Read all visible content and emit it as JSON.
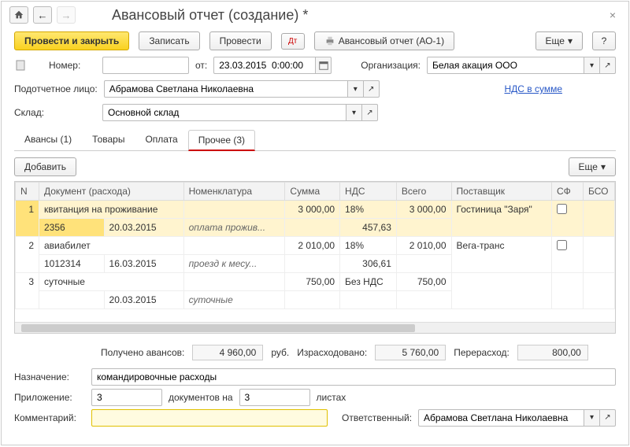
{
  "header": {
    "title": "Авансовый отчет (создание) *"
  },
  "toolbar": {
    "post_close": "Провести и закрыть",
    "save": "Записать",
    "post": "Провести",
    "print": "Авансовый отчет (АО-1)",
    "more": "Еще"
  },
  "form": {
    "number_label": "Номер:",
    "number": "",
    "from_label": "от:",
    "date": "23.03.2015  0:00:00",
    "org_label": "Организация:",
    "org": "Белая акация ООО",
    "person_label": "Подотчетное лицо:",
    "person": "Абрамова Светлана Николаевна",
    "vat_link": "НДС в сумме",
    "warehouse_label": "Склад:",
    "warehouse": "Основной склад"
  },
  "tabs": {
    "t0": "Авансы (1)",
    "t1": "Товары",
    "t2": "Оплата",
    "t3": "Прочее (3)"
  },
  "subtoolbar": {
    "add": "Добавить",
    "more": "Еще"
  },
  "cols": {
    "n": "N",
    "doc": "Документ (расхода)",
    "nomen": "Номенклатура",
    "sum": "Сумма",
    "vat": "НДС",
    "total": "Всего",
    "supplier": "Поставщик",
    "sf": "СФ",
    "bso": "БСО"
  },
  "rows": [
    {
      "n": "1",
      "doc1": "квитанция на проживание",
      "docnum": "2356",
      "docdate": "20.03.2015",
      "nomen": "оплата прожив...",
      "sum": "3 000,00",
      "vat_rate": "18%",
      "vat_sum": "457,63",
      "total": "3 000,00",
      "supplier": "Гостиница \"Заря\""
    },
    {
      "n": "2",
      "doc1": "авиабилет",
      "docnum": "1012314",
      "docdate": "16.03.2015",
      "nomen": "проезд к месу...",
      "sum": "2 010,00",
      "vat_rate": "18%",
      "vat_sum": "306,61",
      "total": "2 010,00",
      "supplier": "Вега-транс"
    },
    {
      "n": "3",
      "doc1": "суточные",
      "docnum": "",
      "docdate": "20.03.2015",
      "nomen": "суточные",
      "sum": "750,00",
      "vat_rate": "Без НДС",
      "vat_sum": "",
      "total": "750,00",
      "supplier": ""
    }
  ],
  "totals": {
    "received_label": "Получено авансов:",
    "received": "4 960,00",
    "rub": "руб.",
    "spent_label": "Израсходовано:",
    "spent": "5 760,00",
    "over_label": "Перерасход:",
    "over": "800,00"
  },
  "bottom": {
    "purpose_label": "Назначение:",
    "purpose": "командировочные расходы",
    "attach_label": "Приложение:",
    "attach_count": "3",
    "attach_mid": "документов на",
    "attach_sheets": "3",
    "attach_end": "листах",
    "comment_label": "Комментарий:",
    "comment": "",
    "resp_label": "Ответственный:",
    "resp": "Абрамова Светлана Николаевна"
  }
}
